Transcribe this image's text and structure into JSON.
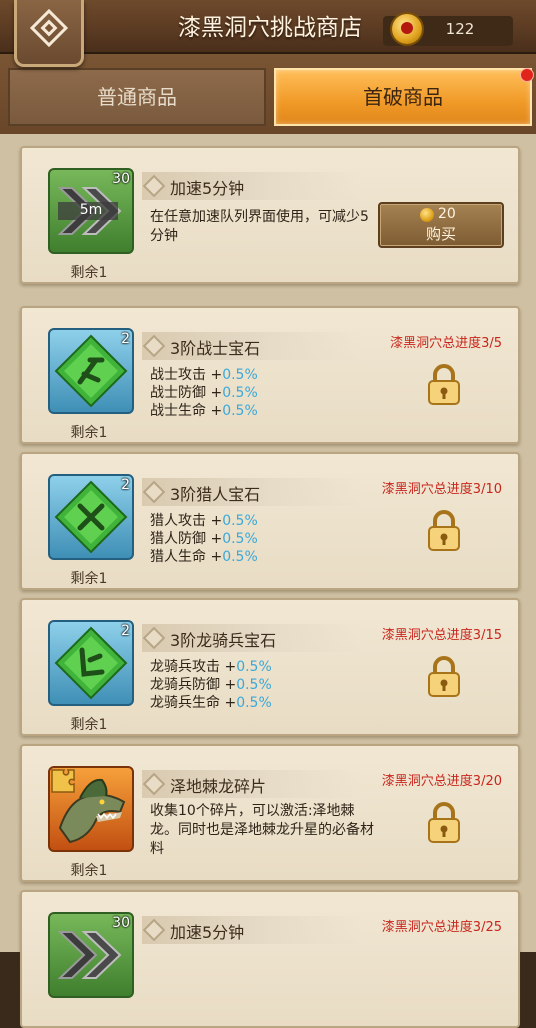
{
  "header": {
    "title": "漆黑洞穴挑战商店",
    "currency": {
      "icon": "gold-coin-icon",
      "value": "122"
    },
    "back_icon": "back-diamond-icon"
  },
  "tabs": [
    {
      "label": "普通商品",
      "active": false
    },
    {
      "label": "首破商品",
      "active": true,
      "notification": true
    }
  ],
  "colors": {
    "accent_tab": "#f09a28",
    "progress_text": "#c8261c",
    "stat_value": "#3ca8d8"
  },
  "items": [
    {
      "name": "加速5分钟",
      "icon": "speedup-5m-icon",
      "icon_text": "5m",
      "count": "30",
      "remain": "剩余1",
      "description": "在任意加速队列界面使用，可减少5分钟",
      "buy": {
        "price": "20",
        "label": "购买"
      }
    },
    {
      "name": "3阶战士宝石",
      "icon": "warrior-gem-icon",
      "count": "2",
      "remain": "剩余1",
      "progress": "漆黑洞穴总进度3/5",
      "stats": [
        {
          "label": "战士攻击",
          "sign": "+",
          "value": "0.5%"
        },
        {
          "label": "战士防御",
          "sign": "+",
          "value": "0.5%"
        },
        {
          "label": "战士生命",
          "sign": "+",
          "value": "0.5%"
        }
      ]
    },
    {
      "name": "3阶猎人宝石",
      "icon": "hunter-gem-icon",
      "count": "2",
      "remain": "剩余1",
      "progress": "漆黑洞穴总进度3/10",
      "stats": [
        {
          "label": "猎人攻击",
          "sign": "+",
          "value": "0.5%"
        },
        {
          "label": "猎人防御",
          "sign": "+",
          "value": "0.5%"
        },
        {
          "label": "猎人生命",
          "sign": "+",
          "value": "0.5%"
        }
      ]
    },
    {
      "name": "3阶龙骑兵宝石",
      "icon": "dragoon-gem-icon",
      "count": "2",
      "remain": "剩余1",
      "progress": "漆黑洞穴总进度3/15",
      "stats": [
        {
          "label": "龙骑兵攻击",
          "sign": "+",
          "value": "0.5%"
        },
        {
          "label": "龙骑兵防御",
          "sign": "+",
          "value": "0.5%"
        },
        {
          "label": "龙骑兵生命",
          "sign": "+",
          "value": "0.5%"
        }
      ]
    },
    {
      "name": "泽地棘龙碎片",
      "icon": "spinosaurus-fragment-icon",
      "remain": "剩余1",
      "progress": "漆黑洞穴总进度3/20",
      "description": "收集10个碎片，可以激活:泽地棘龙。同时也是泽地棘龙升星的必备材料"
    },
    {
      "name": "加速5分钟",
      "icon": "speedup-5m-icon",
      "count": "30",
      "progress": "漆黑洞穴总进度3/25"
    }
  ]
}
